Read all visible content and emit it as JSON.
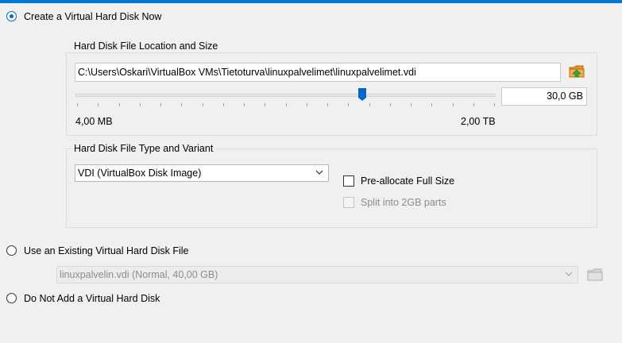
{
  "options": {
    "create_new": "Create a Virtual Hard Disk Now",
    "use_existing": "Use an Existing Virtual Hard Disk File",
    "do_not_add": "Do Not Add a Virtual Hard Disk",
    "selected": "create_new"
  },
  "location_group": {
    "title": "Hard Disk File Location and Size",
    "path": "C:\\Users\\Oskari\\VirtualBox VMs\\Tietoturva\\linuxpalvelimet\\linuxpalvelimet.vdi",
    "size_value": "30,0 GB",
    "size_slider_fraction": 0.683,
    "min_label": "4,00 MB",
    "max_label": "2,00 TB"
  },
  "type_group": {
    "title": "Hard Disk File Type and Variant",
    "disk_type": "VDI (VirtualBox Disk Image)",
    "preallocate_label": "Pre-allocate Full Size",
    "preallocate_checked": false,
    "split_label": "Split into 2GB parts",
    "split_checked": false
  },
  "existing": {
    "selected_file": "linuxpalvelin.vdi (Normal, 40,00 GB)"
  },
  "colors": {
    "accent": "#0078d7",
    "radio_selected": "#0066cc",
    "folder_orange": "#e8922a",
    "arrow_green": "#3aa63a"
  },
  "icons": {
    "folder_icon": "folder-with-green-arrow",
    "existing_folder_icon": "folder-disabled",
    "combo_arrow": "chevron-down"
  }
}
